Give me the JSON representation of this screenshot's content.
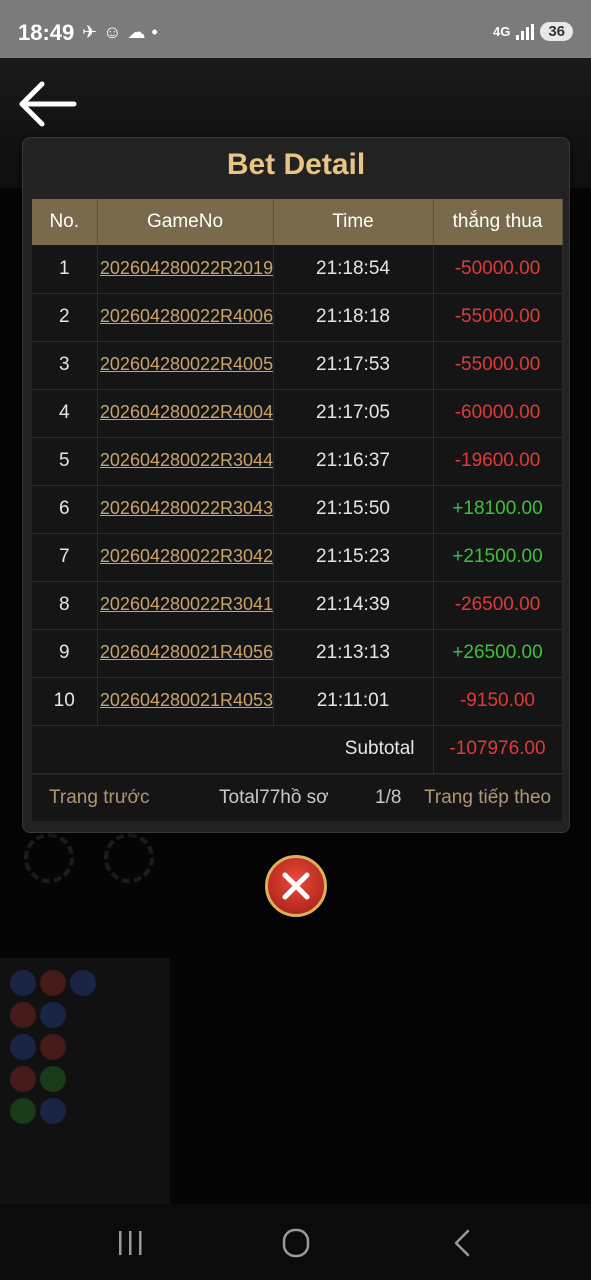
{
  "status": {
    "time": "18:49",
    "network": "4G",
    "battery": "36"
  },
  "modal": {
    "title": "Bet Detail",
    "columns": [
      "No.",
      "GameNo",
      "Time",
      "thắng thua"
    ],
    "rows": [
      {
        "no": "1",
        "game": "202604280022R2019",
        "time": "21:18:54",
        "result": "-50000.00"
      },
      {
        "no": "2",
        "game": "202604280022R4006",
        "time": "21:18:18",
        "result": "-55000.00"
      },
      {
        "no": "3",
        "game": "202604280022R4005",
        "time": "21:17:53",
        "result": "-55000.00"
      },
      {
        "no": "4",
        "game": "202604280022R4004",
        "time": "21:17:05",
        "result": "-60000.00"
      },
      {
        "no": "5",
        "game": "202604280022R3044",
        "time": "21:16:37",
        "result": "-19600.00"
      },
      {
        "no": "6",
        "game": "202604280022R3043",
        "time": "21:15:50",
        "result": "+18100.00"
      },
      {
        "no": "7",
        "game": "202604280022R3042",
        "time": "21:15:23",
        "result": "+21500.00"
      },
      {
        "no": "8",
        "game": "202604280022R3041",
        "time": "21:14:39",
        "result": "-26500.00"
      },
      {
        "no": "9",
        "game": "202604280021R4056",
        "time": "21:13:13",
        "result": "+26500.00"
      },
      {
        "no": "10",
        "game": "202604280021R4053",
        "time": "21:11:01",
        "result": "-9150.00"
      }
    ],
    "subtotal_label": "Subtotal",
    "subtotal_value": "-107976.00",
    "footer": {
      "prev": "Trang trước",
      "total": "Total77hồ sơ",
      "page": "1/8",
      "next": "Trang tiếp theo"
    }
  },
  "colors": {
    "title": "#e9c585",
    "header_bg": "#7a6a4c",
    "loss": "#e03a3a",
    "win": "#3cc23c",
    "link": "#c9a46b"
  },
  "icons": {
    "back": "arrow-left-icon",
    "close": "close-icon",
    "nav_recent": "recent-apps-icon",
    "nav_home": "home-icon",
    "nav_back": "back-icon"
  }
}
